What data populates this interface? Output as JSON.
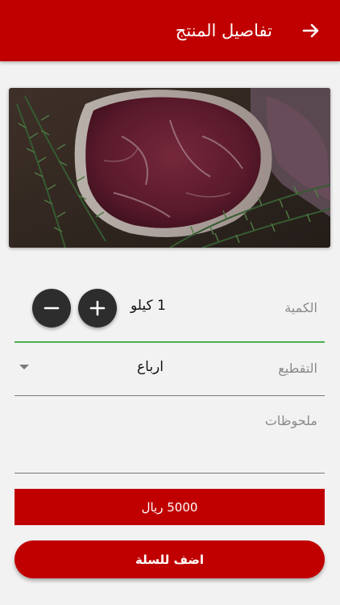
{
  "appbar": {
    "title": "تفاصيل المنتج",
    "back_icon": "arrow-right-icon",
    "color": "#c00000"
  },
  "product_image": {
    "subject": "raw beef steak with rosemary"
  },
  "quantity": {
    "label": "الكمية",
    "value": "1 كيلو",
    "minus_icon": "minus-icon",
    "plus_icon": "plus-icon"
  },
  "cutting": {
    "label": "التقطيع",
    "value": "ارباع",
    "caret_icon": "dropdown-caret-icon"
  },
  "notes": {
    "placeholder": "ملحوظات"
  },
  "price": {
    "text": "5000 ريال"
  },
  "add_to_cart": {
    "label": "اضف للسلة"
  },
  "colors": {
    "primary": "#c00000",
    "focus_line": "#4caf50",
    "button_dark": "#2d2d2d"
  }
}
